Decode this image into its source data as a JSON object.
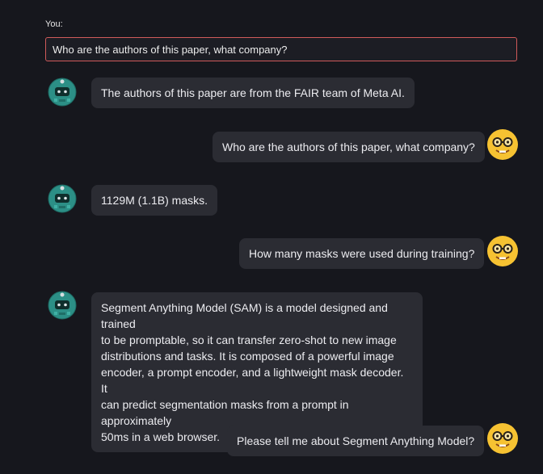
{
  "input": {
    "label": "You:",
    "value": "Who are the authors of this paper, what company?"
  },
  "messages": [
    {
      "role": "bot",
      "text": "The authors of this paper are from the FAIR team of Meta AI."
    },
    {
      "role": "user",
      "text": "Who are the authors of this paper, what company?"
    },
    {
      "role": "bot",
      "text": "1129M (1.1B) masks."
    },
    {
      "role": "user",
      "text": "How many masks were used during training?"
    },
    {
      "role": "bot",
      "lines": [
        "Segment Anything Model (SAM) is a model designed and trained",
        "to be promptable, so it can transfer zero-shot to new image",
        "distributions and tasks. It is composed of a powerful image",
        "encoder, a prompt encoder, and a lightweight mask decoder. It",
        "can predict segmentation masks from a prompt in approximately",
        "50ms in a web browser."
      ]
    },
    {
      "role": "user",
      "text": "Please tell me about Segment Anything Model?"
    }
  ],
  "avatars": {
    "bot_icon": "robot-avatar-icon",
    "user_icon": "nerd-face-emoji-icon"
  }
}
